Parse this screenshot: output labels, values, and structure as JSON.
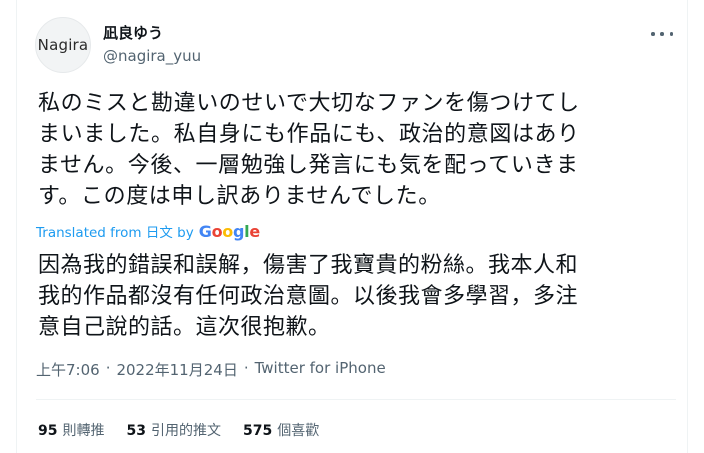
{
  "author": {
    "avatar_text": "Nagira",
    "display_name": "凪良ゆう",
    "handle": "@nagira_yuu"
  },
  "tweet": {
    "lines": [
      "私のミスと勘違いのせいで大切なファンを傷つけてし",
      "まいました。私自身にも作品にも、政治的意図はあり",
      "ません。今後、一層勉強し発言にも気を配っていきま",
      "す。この度は申し訳ありませんでした。"
    ]
  },
  "translation": {
    "label": "Translated from 日文 by",
    "google_letters": [
      "G",
      "o",
      "o",
      "g",
      "l",
      "e"
    ],
    "lines": [
      "因為我的錯誤和誤解，傷害了我寶貴的粉絲。我本人和",
      "我的作品都沒有任何政治意圖。以後我會多學習，多注",
      "意自己說的話。這次很抱歉。"
    ]
  },
  "meta": {
    "time": "上午7:06",
    "separator": "·",
    "date": "2022年11月24日",
    "source": "Twitter for iPhone"
  },
  "stats": [
    {
      "count": "95",
      "label": "則轉推"
    },
    {
      "count": "53",
      "label": "引用的推文"
    },
    {
      "count": "575",
      "label": "個喜歡"
    }
  ]
}
